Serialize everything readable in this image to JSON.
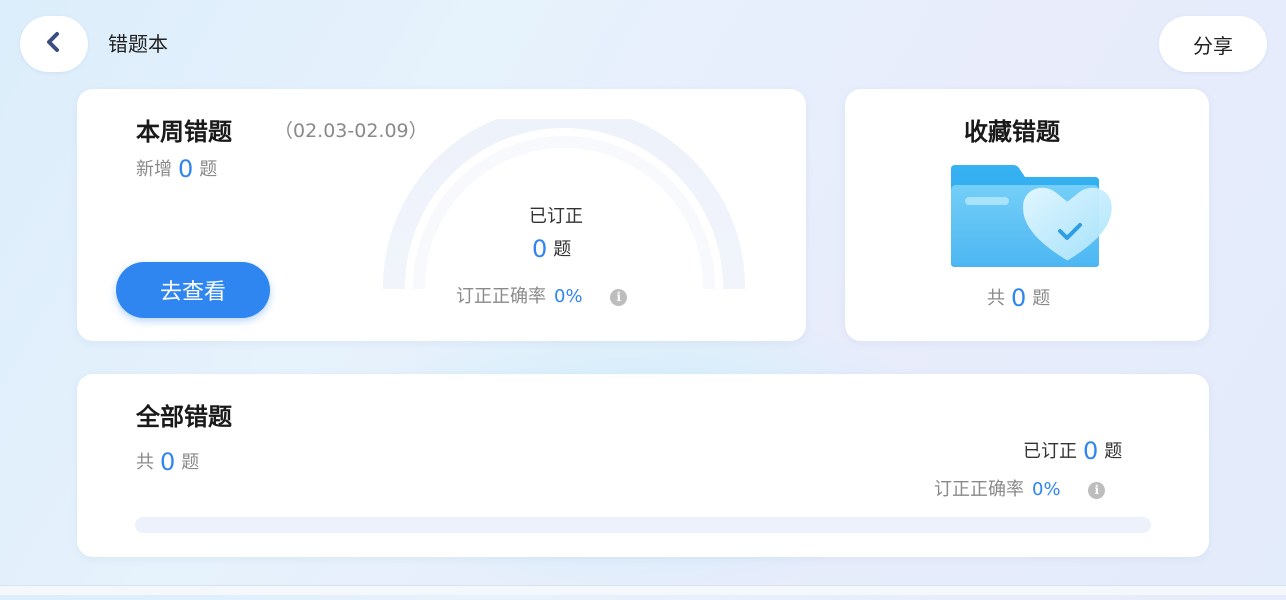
{
  "header": {
    "title": "错题本",
    "back_icon": "chevron-left-icon",
    "share_label": "分享"
  },
  "weekly": {
    "title": "本周错题",
    "date_range": "（02.03-02.09）",
    "new_prefix": "新增",
    "new_count": "0",
    "unit": "题",
    "button_label": "去查看",
    "gauge": {
      "corrected_label": "已订正",
      "corrected_count": "0",
      "unit": "题",
      "rate_label": "订正正确率",
      "rate_value": "0%",
      "rate_fraction": 0
    }
  },
  "favorites": {
    "title": "收藏错题",
    "icon": "folder-heart-icon",
    "total_prefix": "共",
    "total_count": "0",
    "unit": "题"
  },
  "all": {
    "title": "全部错题",
    "total_prefix": "共",
    "total_count": "0",
    "unit": "题",
    "corrected_label": "已订正",
    "corrected_count": "0",
    "corrected_unit": "题",
    "rate_label": "订正正确率",
    "rate_value": "0%",
    "progress_fraction": 0
  },
  "colors": {
    "accent": "#2f86f0",
    "muted_text": "#8a8a8a",
    "track": "#edf1fb"
  },
  "icons": {
    "info": "info-icon"
  }
}
